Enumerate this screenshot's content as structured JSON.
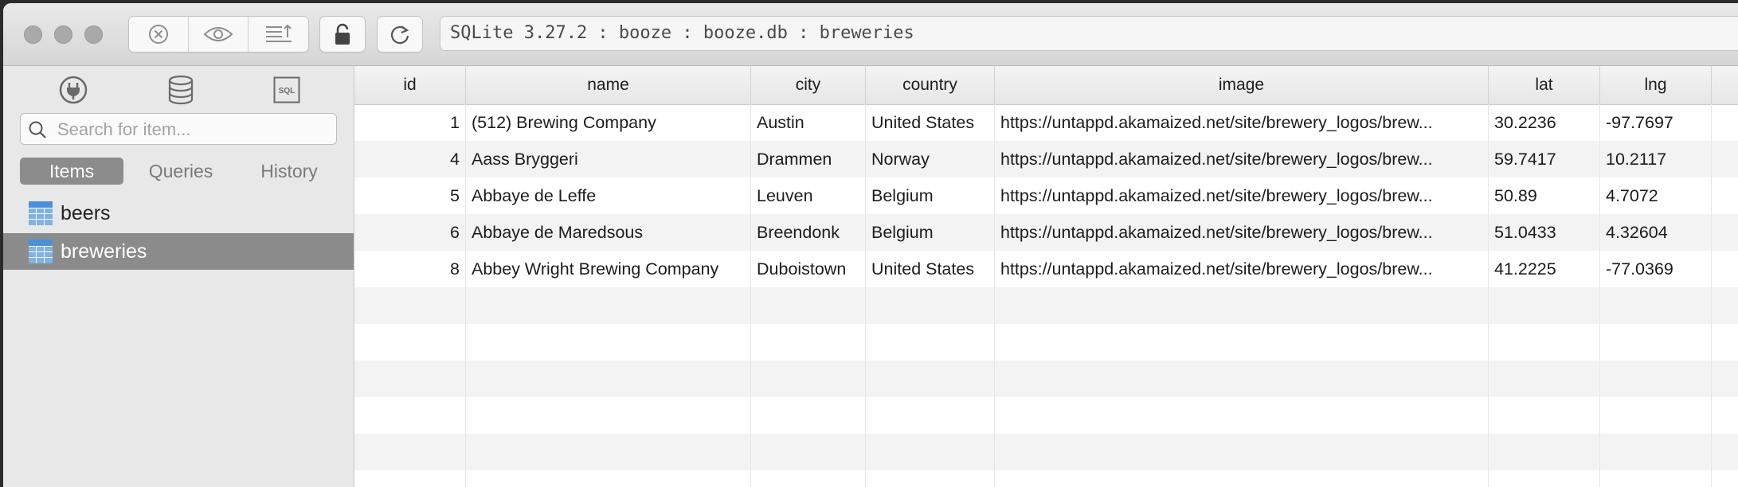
{
  "toolbar": {
    "title": "SQLite 3.27.2 : booze : booze.db : breweries",
    "buttons": [
      "clear-icon",
      "eye-icon",
      "export-icon",
      "lock-icon",
      "refresh-icon"
    ]
  },
  "sidebar": {
    "top_icons": [
      "plug-icon",
      "database-icon",
      "sql-icon"
    ],
    "sql_icon_text": "SQL",
    "search_placeholder": "Search for item...",
    "tabs": [
      {
        "label": "Items",
        "active": true
      },
      {
        "label": "Queries",
        "active": false
      },
      {
        "label": "History",
        "active": false
      }
    ],
    "items": [
      {
        "label": "beers",
        "selected": false
      },
      {
        "label": "breweries",
        "selected": true
      }
    ]
  },
  "grid": {
    "columns": [
      "id",
      "name",
      "city",
      "country",
      "image",
      "lat",
      "lng"
    ],
    "rows": [
      [
        "1",
        "(512) Brewing Company",
        "Austin",
        "United States",
        "https://untappd.akamaized.net/site/brewery_logos/brew...",
        "30.2236",
        "-97.7697"
      ],
      [
        "4",
        "Aass Bryggeri",
        "Drammen",
        "Norway",
        "https://untappd.akamaized.net/site/brewery_logos/brew...",
        "59.7417",
        "10.2117"
      ],
      [
        "5",
        "Abbaye de Leffe",
        "Leuven",
        "Belgium",
        "https://untappd.akamaized.net/site/brewery_logos/brew...",
        "50.89",
        "4.7072"
      ],
      [
        "6",
        "Abbaye de Maredsous",
        "Breendonk",
        "Belgium",
        "https://untappd.akamaized.net/site/brewery_logos/brew...",
        "51.0433",
        "4.32604"
      ],
      [
        "8",
        "Abbey Wright Brewing Company",
        "Duboistown",
        "United States",
        "https://untappd.akamaized.net/site/brewery_logos/brew...",
        "41.2225",
        "-77.0369"
      ]
    ]
  },
  "colors": {
    "selected_bg": "#8b8b8b",
    "table_icon": "#4a90d9"
  }
}
